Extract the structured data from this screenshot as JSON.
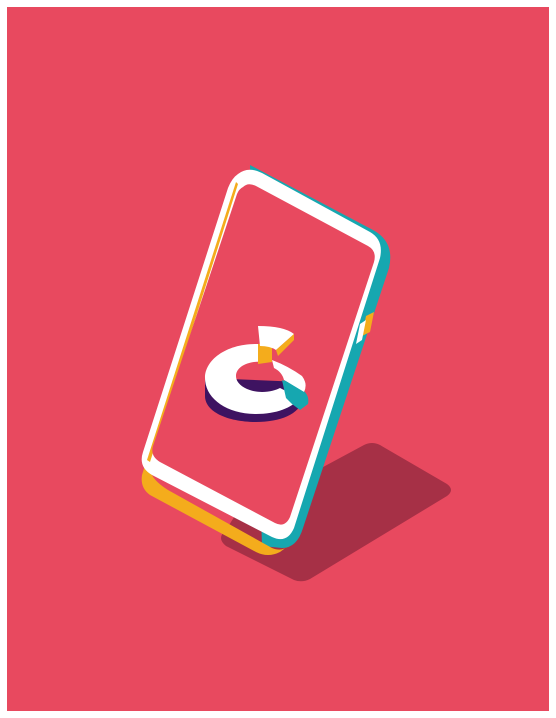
{
  "illustration": {
    "subject": "isometric-smartphone-with-donut-chart",
    "colors": {
      "page_background": "#ffffff",
      "panel_background": "#e8495f",
      "shadow": "#a63046",
      "phone_body": "#ffffff",
      "phone_edge_right": "#16a7b0",
      "phone_edge_left": "#f4ac1c",
      "screen": "#e8495f",
      "ring_top": "#ffffff",
      "ring_side": "#3e1361",
      "slice_orange": "#f4ac1c",
      "slice_teal": "#16a7b0"
    }
  }
}
